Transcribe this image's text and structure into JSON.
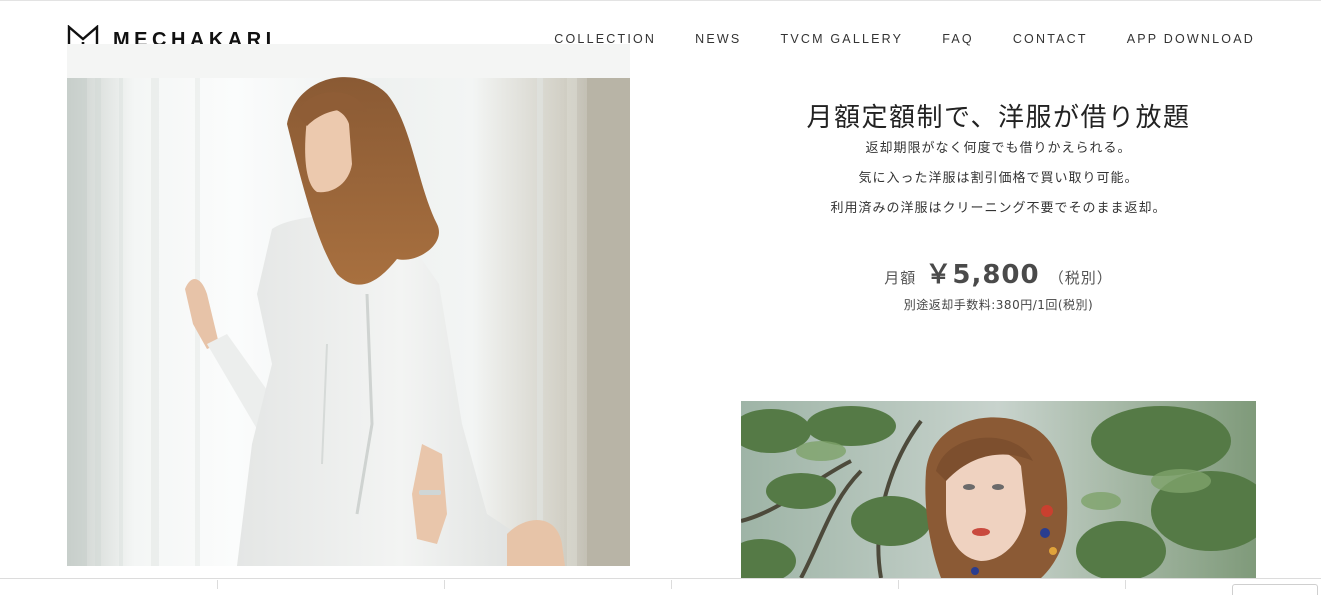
{
  "brand": {
    "name": "MECHAKARI",
    "logo_icon": "mechakari-logo-icon"
  },
  "nav": {
    "items": [
      {
        "label": "COLLECTION"
      },
      {
        "label": "NEWS"
      },
      {
        "label": "TVCM GALLERY"
      },
      {
        "label": "FAQ"
      },
      {
        "label": "CONTACT"
      },
      {
        "label": "APP DOWNLOAD"
      }
    ]
  },
  "hero": {
    "headline": "月額定額制で、洋服が借り放題",
    "lines": [
      "返却期限がなく何度でも借りかえられる。",
      "気に入った洋服は割引価格で買い取り可能。",
      "利用済みの洋服はクリーニング不要でそのまま返却。"
    ],
    "price": {
      "label": "月額",
      "amount": "￥5,800",
      "tax": "（税別）"
    },
    "fee_note": "別途返却手数料:380円/1回(税別)"
  },
  "colors": {
    "text": "#222222",
    "price": "#4a4a4a",
    "rule": "#dcdcdc"
  }
}
